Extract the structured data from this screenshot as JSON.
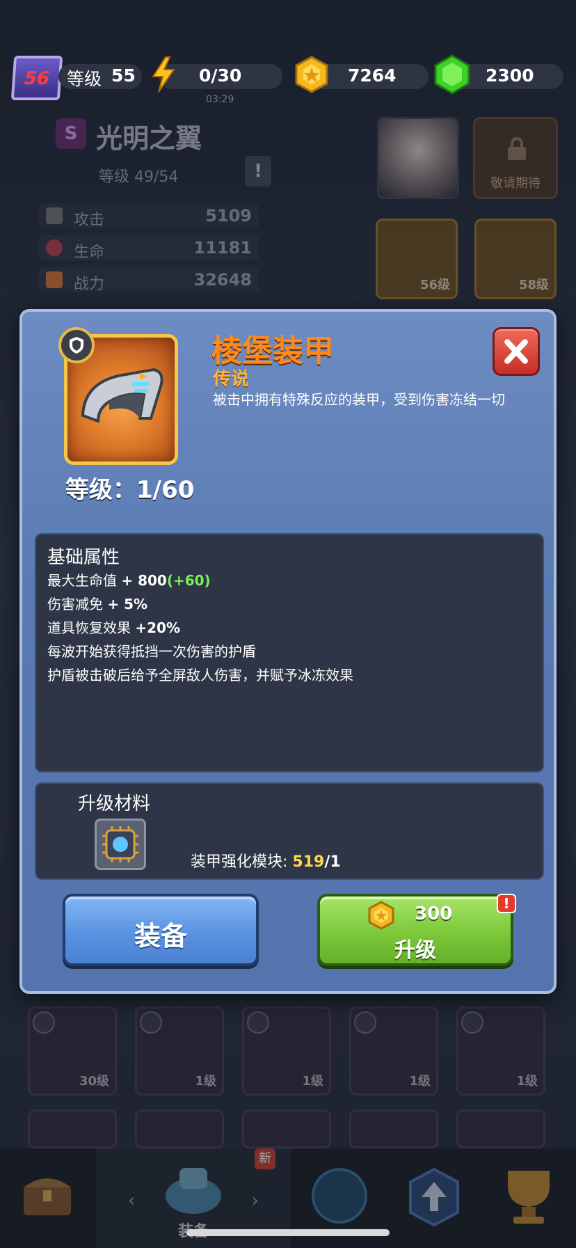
{
  "topbar": {
    "player_level_badge": "56",
    "level_label": "等级",
    "level_value": "55",
    "energy": "0/30",
    "energy_timer": "03:29",
    "coins": "7264",
    "gems": "2300"
  },
  "hero": {
    "rank_letter": "S",
    "name": "光明之翼",
    "level": "等级 49/54",
    "warn_mark": "!",
    "stats": [
      {
        "label": "攻击",
        "value": "5109",
        "icon": "sword-icon"
      },
      {
        "label": "生命",
        "value": "11181",
        "icon": "heart-icon"
      },
      {
        "label": "战力",
        "value": "32648",
        "icon": "flame-icon"
      }
    ],
    "locked_text": "敬请期待",
    "equip_slots": [
      {
        "level": "56级"
      },
      {
        "level": "58级"
      }
    ]
  },
  "modal": {
    "item_name": "棱堡装甲",
    "rarity": "传说",
    "description": "被击中拥有特殊反应的装甲，受到伤害冻结一切",
    "level_text": "等级：1/60",
    "attributes_title": "基础属性",
    "attributes": [
      {
        "text": "最大生命值 ",
        "value": "+ 800",
        "bonus": "(+60)"
      },
      {
        "text": "伤害减免 ",
        "value": "+ 5%",
        "bonus": ""
      },
      {
        "text": "道具恢复效果 ",
        "value": "+20%",
        "bonus": ""
      },
      {
        "text": "每波开始获得抵挡一次伤害的护盾",
        "value": "",
        "bonus": ""
      },
      {
        "text": "护盾被击破后给予全屏敌人伤害，并赋予冰冻效果",
        "value": "",
        "bonus": ""
      }
    ],
    "materials_title": "升级材料",
    "material_name": "装甲强化模块:",
    "material_have": "519",
    "material_need": "/1",
    "equip_label": "装备",
    "upgrade_cost": "300",
    "upgrade_label": "升级",
    "upgrade_alert": "!",
    "colors": {
      "title": "#ff8a1c",
      "rarity": "#ffb43a",
      "bonus": "#7cf05a",
      "material_count": "#ffd84a"
    }
  },
  "inventory": {
    "row1_levels": [
      "30级",
      "1级",
      "1级",
      "1级",
      "1级"
    ]
  },
  "bottom_nav": {
    "active_label": "装备",
    "new_badge": "新"
  }
}
